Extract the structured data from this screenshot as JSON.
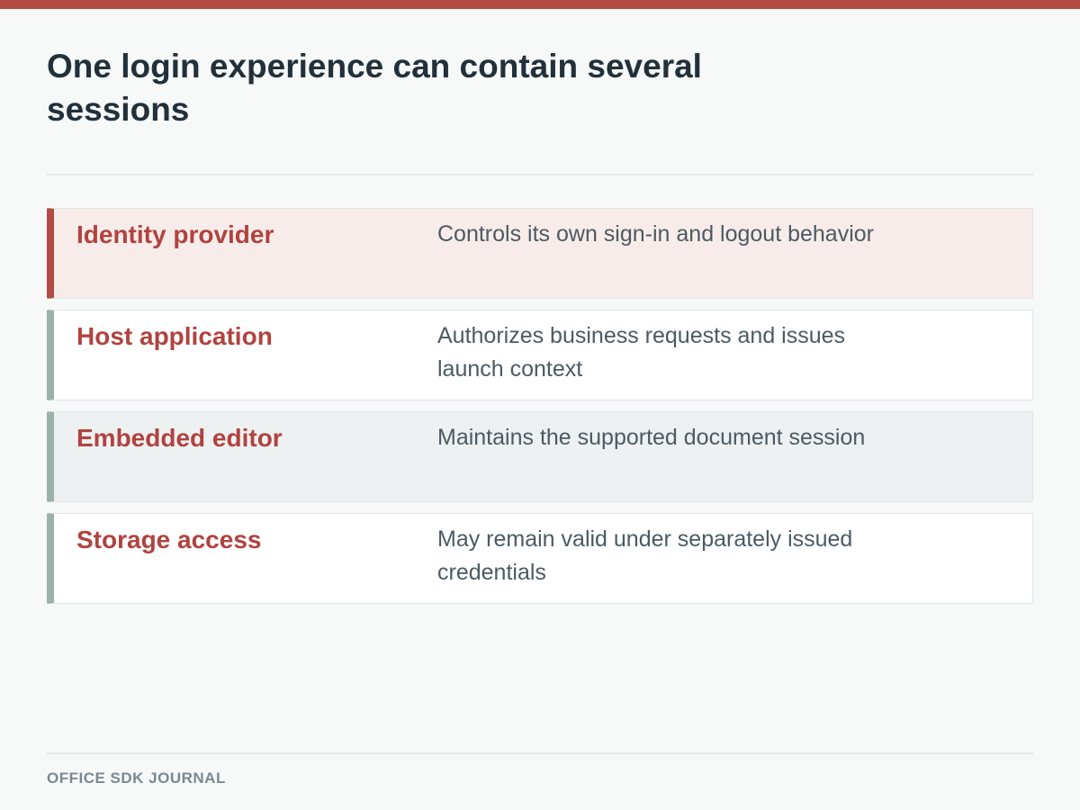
{
  "colors": {
    "accent": "#b44b45",
    "neutral_bar": "#9ab2aa",
    "title": "#22303a",
    "body_text": "#4c5a62",
    "footer": "#7b8890"
  },
  "page": {
    "title": "One login experience can contain several sessions"
  },
  "rows": [
    {
      "label": "Identity provider",
      "description": "Controls its own sign-in and logout behavior"
    },
    {
      "label": "Host application",
      "description": "Authorizes business requests and issues launch context"
    },
    {
      "label": "Embedded editor",
      "description": "Maintains the supported document session"
    },
    {
      "label": "Storage access",
      "description": "May remain valid under separately issued credentials"
    }
  ],
  "footer": {
    "text": "OFFICE SDK JOURNAL"
  }
}
